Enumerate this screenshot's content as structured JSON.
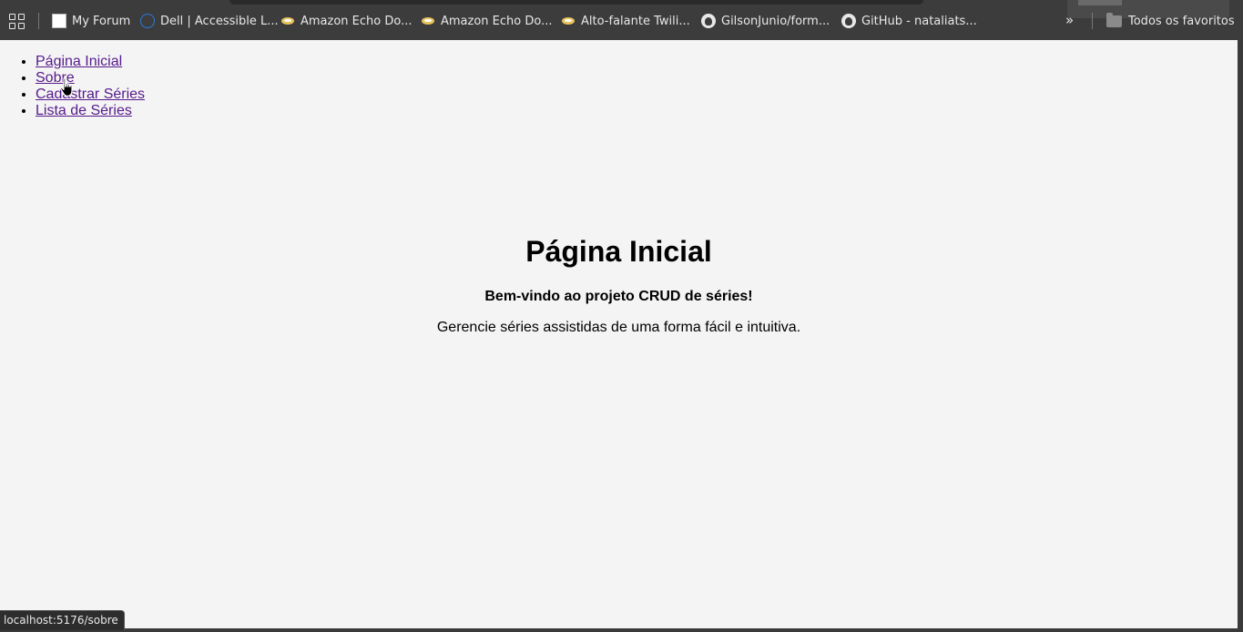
{
  "bookmarks_bar": {
    "items": [
      {
        "label": "My Forum",
        "icon": "forum-icon"
      },
      {
        "label": "Dell | Accessible L...",
        "icon": "dell-icon"
      },
      {
        "label": "Amazon Echo Do...",
        "icon": "amazon-icon"
      },
      {
        "label": "Amazon Echo Do...",
        "icon": "amazon-icon"
      },
      {
        "label": "Alto-falante Twili...",
        "icon": "amazon-icon"
      },
      {
        "label": "GilsonJunio/form...",
        "icon": "github-icon"
      },
      {
        "label": "GitHub - nataliats...",
        "icon": "github-icon"
      }
    ],
    "more_icon": "»",
    "all_bookmarks_label": "Todos os favoritos"
  },
  "nav": {
    "items": [
      {
        "label": "Página Inicial"
      },
      {
        "label": "Sobre"
      },
      {
        "label": "Cadastrar Séries"
      },
      {
        "label": "Lista de Séries"
      }
    ]
  },
  "main": {
    "title": "Página Inicial",
    "welcome": "Bem-vindo ao projeto CRUD de séries!",
    "description": "Gerencie séries assistidas de uma forma fácil e intuitiva."
  },
  "status_bar": {
    "url": "localhost:5176/sobre"
  },
  "colors": {
    "link_visited": "#551a8b",
    "page_background": "#f4f4f4",
    "bookmarks_background": "#3c3c3c"
  }
}
